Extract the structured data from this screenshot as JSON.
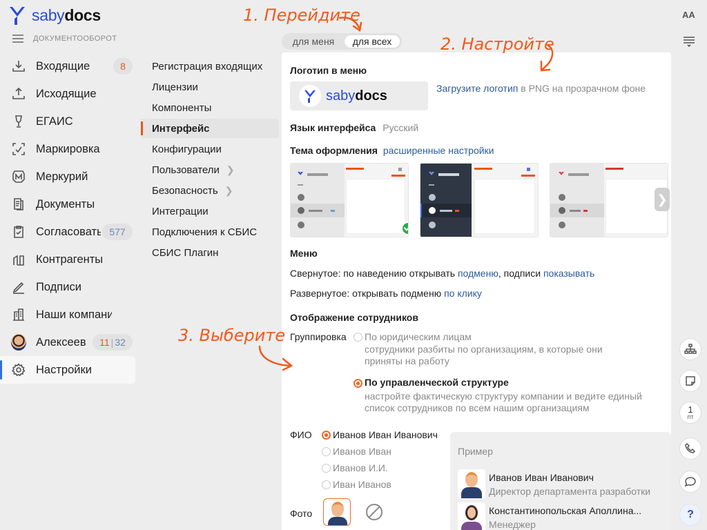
{
  "app": {
    "logo_part1": "saby",
    "logo_part2": "docs",
    "section_subtitle": "ДОКУМЕНТООБОРОТ"
  },
  "sidebar": {
    "items": [
      {
        "label": "Входящие",
        "count": "8",
        "icon": "inbox-icon"
      },
      {
        "label": "Исходящие",
        "icon": "outbox-icon"
      },
      {
        "label": "ЕГАИС",
        "icon": "wineglass-icon"
      },
      {
        "label": "Маркировка",
        "icon": "marking-icon"
      },
      {
        "label": "Меркурий",
        "icon": "mercury-icon"
      },
      {
        "label": "Документы",
        "icon": "documents-icon"
      },
      {
        "label": "Согласовать",
        "count": "577",
        "icon": "approval-icon"
      },
      {
        "label": "Контрагенты",
        "icon": "contractors-icon"
      },
      {
        "label": "Подписи",
        "icon": "signature-icon"
      },
      {
        "label": "Наши компании",
        "icon": "companies-icon"
      },
      {
        "label": "Алексеев",
        "count_a": "11",
        "count_b": "32",
        "icon": "avatar"
      },
      {
        "label": "Настройки",
        "icon": "gear-icon",
        "active": true
      }
    ]
  },
  "submenu": {
    "items": [
      {
        "label": "Регистрация входящих"
      },
      {
        "label": "Лицензии"
      },
      {
        "label": "Компоненты"
      },
      {
        "label": "Интерфейс",
        "active": true
      },
      {
        "label": "Конфигурации"
      },
      {
        "label": "Пользователи",
        "chevron": true
      },
      {
        "label": "Безопасность",
        "chevron": true
      },
      {
        "label": "Интеграции"
      },
      {
        "label": "Подключения к СБИС"
      },
      {
        "label": "СБИС Плагин"
      }
    ]
  },
  "tabs": [
    {
      "label": "для меня"
    },
    {
      "label": "для всех",
      "active": true
    }
  ],
  "panel": {
    "logo_heading": "Логотип в меню",
    "logo_part1": "saby",
    "logo_part2": "docs",
    "upload_link": "Загрузите логотип",
    "upload_hint": "в PNG на прозрачном фоне",
    "lang_label": "Язык интерфейса",
    "lang_value": "Русский",
    "theme_label": "Тема оформления",
    "theme_link": "расширенные настройки",
    "menu_heading": "Меню",
    "collapsed_prefix": "Свернутое: по наведению открывать",
    "collapsed_link1": "подменю",
    "collapsed_mid": ", подписи",
    "collapsed_link2": "показывать",
    "expanded_prefix": "Развернутое: открывать подменю",
    "expanded_link": "по клику",
    "staff_heading": "Отображение сотрудников",
    "grouping_label": "Группировка",
    "group_opt1_title": "По юридическим лицам",
    "group_opt1_desc1": "сотрудники разбиты по организациям, в которые они",
    "group_opt1_desc2": "приняты на работу",
    "group_opt2_title": "По управленческой структуре",
    "group_opt2_desc1": "настройте фактическую структуру компании и ведите единый",
    "group_opt2_desc2": "список сотрудников по всем нашим организациям",
    "fio_label": "ФИО",
    "fio_options": [
      "Иванов Иван Иванович",
      "Иванов Иван",
      "Иванов И.И.",
      "Иван Иванов"
    ],
    "photo_label": "Фото",
    "example_title": "Пример",
    "example_people": [
      {
        "name": "Иванов Иван Иванович",
        "role": "Директор департамента разработки"
      },
      {
        "name": "Константинопольская Аполлина...",
        "role": "Менеджер"
      }
    ]
  },
  "rightbar": {
    "font_toggle": "AA",
    "calendar_day": "1",
    "calendar_weekday": "пт",
    "help": "?"
  },
  "annotations": {
    "step1": "1. Перейдите",
    "step2": "2. Настройте",
    "step3": "3. Выберите"
  },
  "colors": {
    "accent_orange": "#f05a1a",
    "link_blue": "#2d5a9b",
    "brand_blue": "#2b4bd8",
    "check_green": "#2eac4d"
  }
}
